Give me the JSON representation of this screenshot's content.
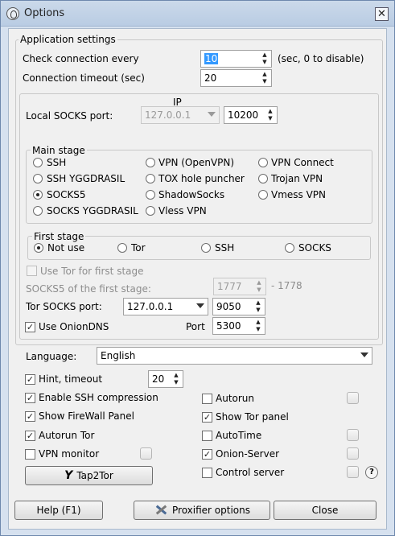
{
  "window": {
    "title": "Options",
    "close_glyph": "✕"
  },
  "app_settings": {
    "legend": "Application settings",
    "check_label": "Check connection every",
    "check_value": "10",
    "check_hint": "(sec, 0 to disable)",
    "timeout_label": "Connection timeout (sec)",
    "timeout_value": "20"
  },
  "proxy": {
    "ip_header": "IP",
    "local_socks_label": "Local SOCKS port:",
    "local_ip": "127.0.0.1",
    "local_port": "10200",
    "main_stage": {
      "legend": "Main stage",
      "options": [
        "SSH",
        "VPN (OpenVPN)",
        "VPN Connect",
        "SSH YGGDRASIL",
        "TOX hole puncher",
        "Trojan VPN",
        "SOCKS5",
        "ShadowSocks",
        "Vmess VPN",
        "SOCKS YGGDRASIL",
        "Vless VPN"
      ],
      "selected": "SOCKS5"
    },
    "first_stage": {
      "legend": "First stage",
      "options": [
        "Not use",
        "Tor",
        "SSH",
        "SOCKS"
      ],
      "selected": "Not use"
    },
    "use_tor_first_label": "Use Tor for first stage",
    "socks5_first_label": "SOCKS5 of the first stage:",
    "socks5_first_port": "1777",
    "socks5_first_range": "- 1778",
    "tor_socks_label": "Tor SOCKS port:",
    "tor_ip": "127.0.0.1",
    "tor_port": "9050",
    "onion_dns_label": "Use OnionDNS",
    "onion_dns_checked": true,
    "port_label": "Port",
    "onion_dns_port": "5300"
  },
  "general": {
    "language_label": "Language:",
    "language_value": "English",
    "hint_label": "Hint, timeout",
    "hint_checked": true,
    "hint_value": "20",
    "left_checks": [
      {
        "label": "Enable SSH compression",
        "checked": true
      },
      {
        "label": "Show FireWall Panel",
        "checked": true
      },
      {
        "label": "Autorun Tor",
        "checked": true
      },
      {
        "label": "VPN monitor",
        "checked": false
      }
    ],
    "right_checks": [
      {
        "label": "Autorun",
        "checked": false
      },
      {
        "label": "Show Tor panel",
        "checked": true
      },
      {
        "label": "AutoTime",
        "checked": false
      },
      {
        "label": "Onion-Server",
        "checked": true
      },
      {
        "label": "Control server",
        "checked": false
      }
    ],
    "tap2tor_label": "Tap2Tor",
    "help_glyph": "?"
  },
  "footer": {
    "help_label": "Help (F1)",
    "proxifier_label": "Proxifier options",
    "close_label": "Close"
  },
  "colors": {
    "window_frame": "#d6e1ef",
    "selection": "#3399ff",
    "client_bg": "#f0f0f0"
  },
  "icons": {
    "app": "app-shield-icon",
    "tap2tor": "y-logo-icon",
    "proxifier": "tools-icon"
  }
}
